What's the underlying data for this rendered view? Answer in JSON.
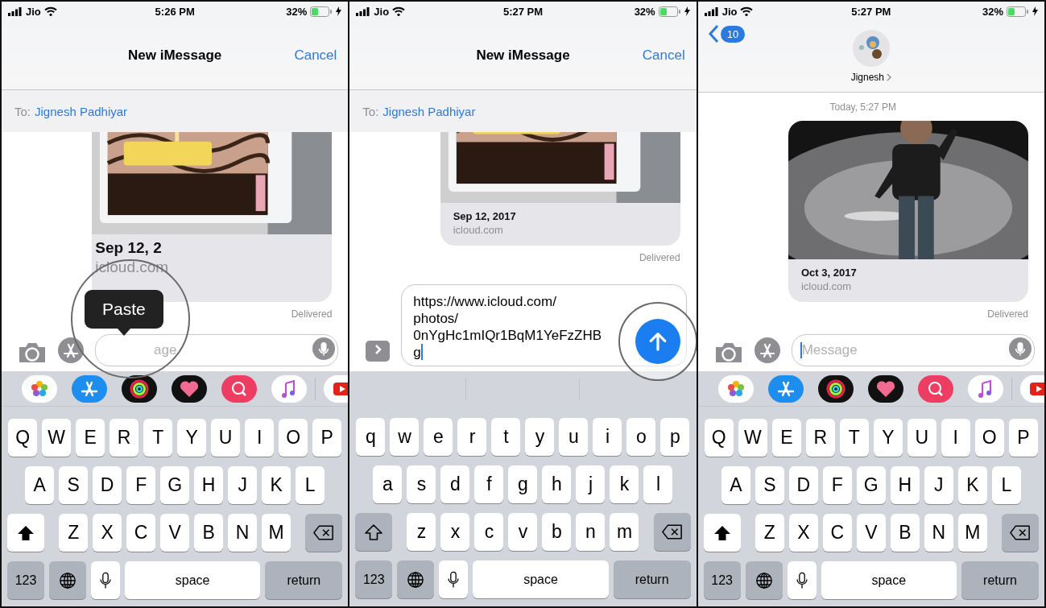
{
  "screens": [
    {
      "status": {
        "carrier": "Jio",
        "time": "5:26 PM",
        "battery": "32%"
      },
      "header": {
        "kind": "compose",
        "title": "New iMessage",
        "action": "Cancel"
      },
      "to": {
        "label": "To:",
        "recipient": "Jignesh Padhiyar"
      },
      "bubble": {
        "date": "Sep 12, 2",
        "domain": "icloud.com"
      },
      "delivered": "Delivered",
      "composer": {
        "kind": "compose",
        "placeholder": "age",
        "focused": false
      },
      "magnifier": {
        "kind": "paste",
        "label": "Paste"
      },
      "tray": {
        "kind": "apps"
      },
      "keyboard": {
        "shift": true,
        "rows": [
          [
            "Q",
            "W",
            "E",
            "R",
            "T",
            "Y",
            "U",
            "I",
            "O",
            "P"
          ],
          [
            "A",
            "S",
            "D",
            "F",
            "G",
            "H",
            "J",
            "K",
            "L"
          ],
          [
            "Z",
            "X",
            "C",
            "V",
            "B",
            "N",
            "M"
          ]
        ],
        "mode": "123",
        "space": "space",
        "return": "return"
      }
    },
    {
      "status": {
        "carrier": "Jio",
        "time": "5:27 PM",
        "battery": "32%"
      },
      "header": {
        "kind": "compose",
        "title": "New iMessage",
        "action": "Cancel"
      },
      "to": {
        "label": "To:",
        "recipient": "Jignesh Padhiyar"
      },
      "bubble": {
        "date": "Sep 12, 2017",
        "domain": "icloud.com"
      },
      "delivered": "Delivered",
      "composer": {
        "kind": "typing",
        "value": "https://www.icloud.com/\nphotos/\n0nYgHc1mIQr1BqM1YeFzZHB\ng",
        "focused": true
      },
      "magnifier": {
        "kind": "send"
      },
      "tray": {
        "kind": "suggestions"
      },
      "keyboard": {
        "shift": false,
        "rows": [
          [
            "q",
            "w",
            "e",
            "r",
            "t",
            "y",
            "u",
            "i",
            "o",
            "p"
          ],
          [
            "a",
            "s",
            "d",
            "f",
            "g",
            "h",
            "j",
            "k",
            "l"
          ],
          [
            "z",
            "x",
            "c",
            "v",
            "b",
            "n",
            "m"
          ]
        ],
        "mode": "123",
        "space": "space",
        "return": "return"
      }
    },
    {
      "status": {
        "carrier": "Jio",
        "time": "5:27 PM",
        "battery": "32%"
      },
      "header": {
        "kind": "conversation",
        "badge": "10",
        "contact": "Jignesh"
      },
      "timestamp": "Today, 5:27 PM",
      "bubble": {
        "date": "Oct 3, 2017",
        "domain": "icloud.com"
      },
      "delivered": "Delivered",
      "composer": {
        "kind": "compose",
        "placeholder": "Message",
        "focused": true
      },
      "tray": {
        "kind": "apps"
      },
      "keyboard": {
        "shift": true,
        "rows": [
          [
            "Q",
            "W",
            "E",
            "R",
            "T",
            "Y",
            "U",
            "I",
            "O",
            "P"
          ],
          [
            "A",
            "S",
            "D",
            "F",
            "G",
            "H",
            "J",
            "K",
            "L"
          ],
          [
            "Z",
            "X",
            "C",
            "V",
            "B",
            "N",
            "M"
          ]
        ],
        "mode": "123",
        "space": "space",
        "return": "return"
      }
    }
  ]
}
